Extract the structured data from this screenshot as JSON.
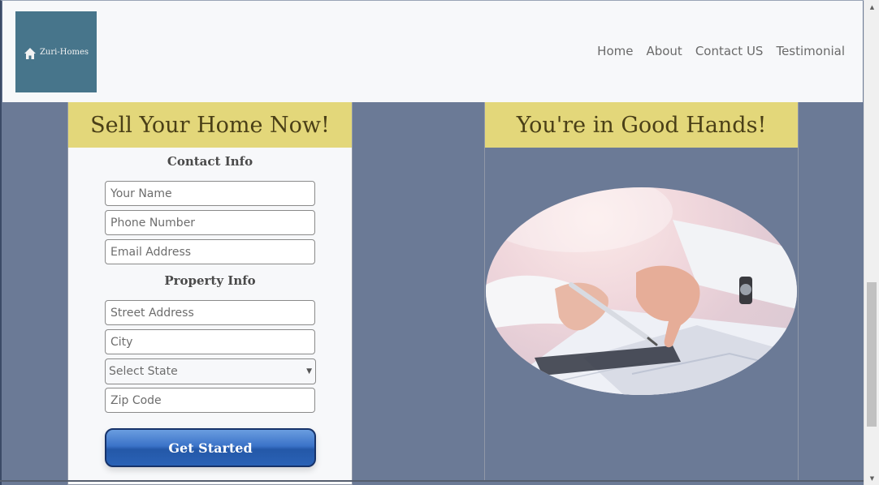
{
  "header": {
    "logo_text": "Zuri-Homes",
    "nav": [
      {
        "label": "Home"
      },
      {
        "label": "About"
      },
      {
        "label": "Contact US"
      },
      {
        "label": "Testimonial"
      }
    ]
  },
  "form_panel": {
    "heading": "Sell Your Home Now!",
    "contact_title": "Contact Info",
    "name_placeholder": "Your Name",
    "phone_placeholder": "Phone Number",
    "email_placeholder": "Email Address",
    "property_title": "Property Info",
    "street_placeholder": "Street Address",
    "city_placeholder": "City",
    "state_selected": "Select State",
    "zip_placeholder": "Zip Code",
    "submit_label": "Get Started"
  },
  "image_panel": {
    "heading": "You're in Good Hands!"
  },
  "colors": {
    "page_bg": "#6b7a96",
    "heading_bg": "#e3d77a",
    "logo_bg": "#47758b",
    "button": "#2458a8"
  },
  "icons": {
    "logo": "home-icon",
    "select": "chevron-down-icon"
  }
}
